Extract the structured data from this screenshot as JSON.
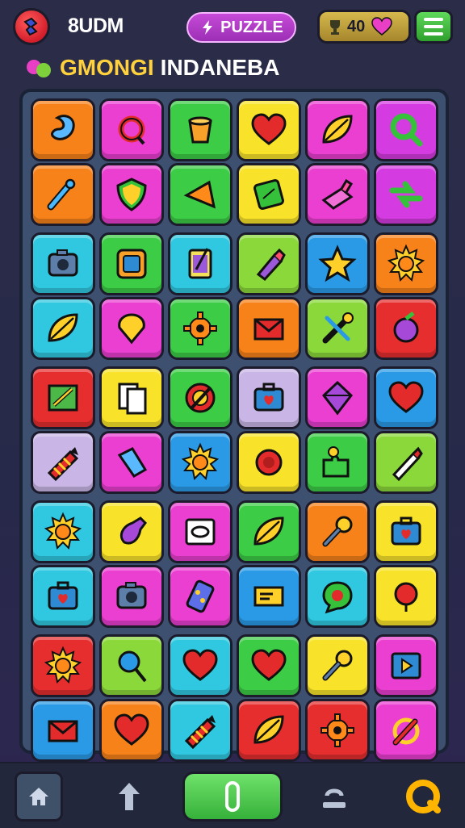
{
  "header": {
    "app_name": "8UDM",
    "mode_label": "PUZZLE",
    "coin_count": "40",
    "logo_icon": "puzzle-piece-icon",
    "mode_icon": "lightning-icon",
    "coin_icon": "trophy-icon",
    "heart_icon": "heart-icon",
    "menu_icon": "menu-icon"
  },
  "level": {
    "title_part1": "GMONGI",
    "title_part2": "INDANEBA"
  },
  "board": {
    "columns": 6,
    "rows": 10,
    "tiles": [
      {
        "color": "#f7821a",
        "icon": "bean"
      },
      {
        "color": "#ea3fd0",
        "icon": "ring"
      },
      {
        "color": "#3ccc46",
        "icon": "bucket"
      },
      {
        "color": "#f9e32a",
        "icon": "heart"
      },
      {
        "color": "#ea3fd0",
        "icon": "leaf"
      },
      {
        "color": "#d43be0",
        "icon": "magnifier"
      },
      {
        "color": "#f7821a",
        "icon": "wand"
      },
      {
        "color": "#ea3fd0",
        "icon": "shield"
      },
      {
        "color": "#3ccc46",
        "icon": "kite"
      },
      {
        "color": "#f9e32a",
        "icon": "card"
      },
      {
        "color": "#ea3fd0",
        "icon": "book"
      },
      {
        "color": "#d43be0",
        "icon": "arrows"
      },
      {
        "color": "#30c8e0",
        "icon": "camera"
      },
      {
        "color": "#3ccc46",
        "icon": "frame"
      },
      {
        "color": "#30c8e0",
        "icon": "phone"
      },
      {
        "color": "#8bd83a",
        "icon": "lipstick"
      },
      {
        "color": "#2a9ae6",
        "icon": "star"
      },
      {
        "color": "#f7821a",
        "icon": "sun"
      },
      {
        "color": "#30c8e0",
        "icon": "leaf"
      },
      {
        "color": "#ea3fd0",
        "icon": "balloon"
      },
      {
        "color": "#3ccc46",
        "icon": "gear"
      },
      {
        "color": "#f7821a",
        "icon": "envelope"
      },
      {
        "color": "#8bd83a",
        "icon": "tools"
      },
      {
        "color": "#e62e2e",
        "icon": "plum"
      },
      {
        "color": "#e62e2e",
        "icon": "palette"
      },
      {
        "color": "#f9e32a",
        "icon": "cards"
      },
      {
        "color": "#3ccc46",
        "icon": "target"
      },
      {
        "color": "#c9b6e6",
        "icon": "briefcase"
      },
      {
        "color": "#ea3fd0",
        "icon": "gem"
      },
      {
        "color": "#2a9ae6",
        "icon": "heart"
      },
      {
        "color": "#c9b6e6",
        "icon": "crayon"
      },
      {
        "color": "#ea3fd0",
        "icon": "ribbon"
      },
      {
        "color": "#2a9ae6",
        "icon": "sun"
      },
      {
        "color": "#f9e32a",
        "icon": "flower"
      },
      {
        "color": "#3ccc46",
        "icon": "puzzle"
      },
      {
        "color": "#8bd83a",
        "icon": "pencil"
      },
      {
        "color": "#30c8e0",
        "icon": "sun"
      },
      {
        "color": "#f9e32a",
        "icon": "vase"
      },
      {
        "color": "#ea3fd0",
        "icon": "photo"
      },
      {
        "color": "#3ccc46",
        "icon": "leaf"
      },
      {
        "color": "#f7821a",
        "icon": "key"
      },
      {
        "color": "#f9e32a",
        "icon": "briefcase"
      },
      {
        "color": "#30c8e0",
        "icon": "briefcase"
      },
      {
        "color": "#ea3fd0",
        "icon": "camera"
      },
      {
        "color": "#ea3fd0",
        "icon": "domino"
      },
      {
        "color": "#2a9ae6",
        "icon": "ticket"
      },
      {
        "color": "#30c8e0",
        "icon": "bubble"
      },
      {
        "color": "#f9e32a",
        "icon": "apple"
      },
      {
        "color": "#e62e2e",
        "icon": "sun"
      },
      {
        "color": "#8bd83a",
        "icon": "lollipop"
      },
      {
        "color": "#30c8e0",
        "icon": "heart"
      },
      {
        "color": "#3ccc46",
        "icon": "heart"
      },
      {
        "color": "#f9e32a",
        "icon": "key"
      },
      {
        "color": "#ea3fd0",
        "icon": "tv"
      },
      {
        "color": "#2a9ae6",
        "icon": "envelope"
      },
      {
        "color": "#f7821a",
        "icon": "heart"
      },
      {
        "color": "#30c8e0",
        "icon": "crayon"
      },
      {
        "color": "#e62e2e",
        "icon": "leaf"
      },
      {
        "color": "#e62e2e",
        "icon": "gear"
      },
      {
        "color": "#ea3fd0",
        "icon": "pen"
      }
    ]
  },
  "nav": {
    "home_icon": "home-icon",
    "up_icon": "arrow-up-icon",
    "play_icon": "play-icon",
    "reset_icon": "reset-icon",
    "hint_icon": "hint-icon"
  }
}
